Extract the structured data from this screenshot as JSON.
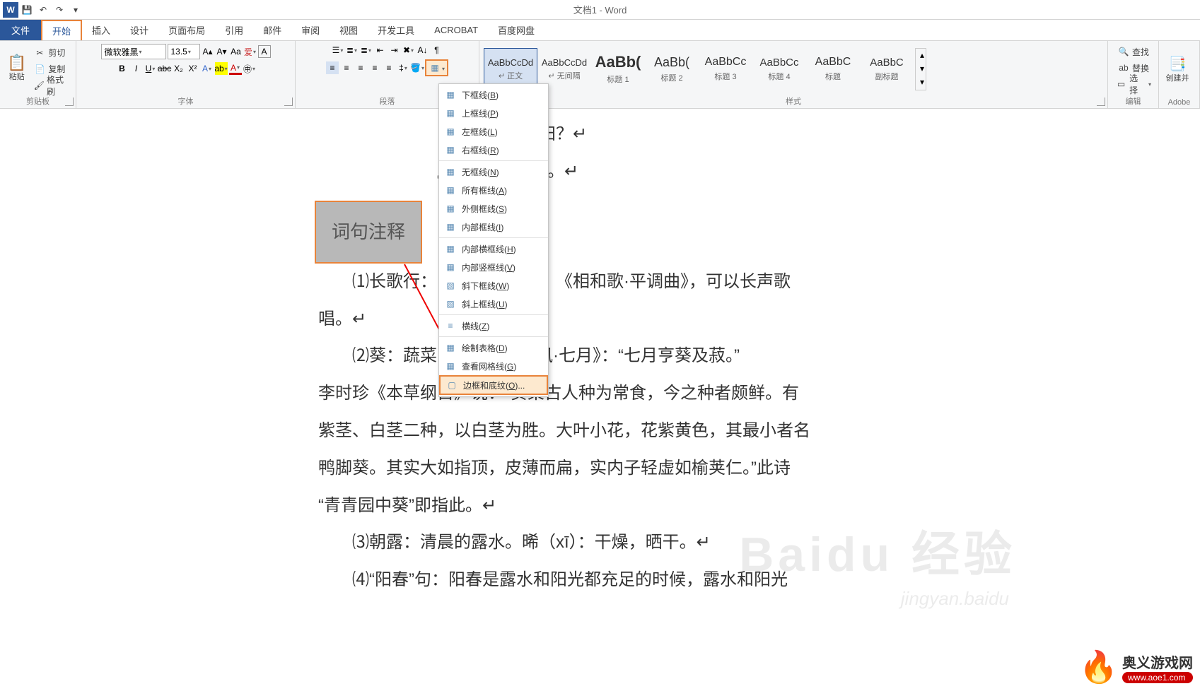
{
  "title": "文档1 - Word",
  "qat": {
    "save": "💾",
    "undo": "↶",
    "redo": "↷"
  },
  "tabs": {
    "file": "文件",
    "home": "开始",
    "insert": "插入",
    "design": "设计",
    "layout": "页面布局",
    "ref": "引用",
    "mail": "邮件",
    "review": "审阅",
    "view": "视图",
    "dev": "开发工具",
    "acrobat": "ACROBAT",
    "baidu": "百度网盘"
  },
  "clipboard": {
    "label": "剪贴板",
    "paste": "粘贴",
    "cut": "剪切",
    "copy": "复制",
    "fmt": "格式刷"
  },
  "font": {
    "label": "字体",
    "name": "微软雅黑",
    "size": "13.5"
  },
  "paragraph": {
    "label": "段落"
  },
  "stylesGroup": {
    "label": "样式"
  },
  "editing": {
    "label": "编辑",
    "find": "查找",
    "replace": "替换",
    "select": "选择"
  },
  "adobe": {
    "label": "Adobe",
    "create": "创建并"
  },
  "styles": [
    {
      "prev": "AaBbCcDd",
      "name": "↵ 正文",
      "size": "13px"
    },
    {
      "prev": "AaBbCcDd",
      "name": "↵ 无间隔",
      "size": "13px"
    },
    {
      "prev": "AaBb(",
      "name": "标题 1",
      "size": "22px",
      "bold": true
    },
    {
      "prev": "AaBb(",
      "name": "标题 2",
      "size": "18px"
    },
    {
      "prev": "AaBbCc",
      "name": "标题 3",
      "size": "16px"
    },
    {
      "prev": "AaBbCc",
      "name": "标题 4",
      "size": "15px"
    },
    {
      "prev": "AaBbC",
      "name": "标题",
      "size": "16px"
    },
    {
      "prev": "AaBbC",
      "name": "副标题",
      "size": "15px"
    }
  ],
  "borderMenu": [
    {
      "ico": "▦",
      "label": "下框线(B)",
      "u": "B"
    },
    {
      "ico": "▦",
      "label": "上框线(P)",
      "u": "P"
    },
    {
      "ico": "▦",
      "label": "左框线(L)",
      "u": "L"
    },
    {
      "ico": "▦",
      "label": "右框线(R)",
      "u": "R"
    },
    {
      "sep": true
    },
    {
      "ico": "▦",
      "label": "无框线(N)",
      "u": "N"
    },
    {
      "ico": "▦",
      "label": "所有框线(A)",
      "u": "A"
    },
    {
      "ico": "▦",
      "label": "外侧框线(S)",
      "u": "S"
    },
    {
      "ico": "▦",
      "label": "内部框线(I)",
      "u": "I"
    },
    {
      "sep": true
    },
    {
      "ico": "▦",
      "label": "内部横框线(H)",
      "u": "H"
    },
    {
      "ico": "▦",
      "label": "内部竖框线(V)",
      "u": "V"
    },
    {
      "ico": "▧",
      "label": "斜下框线(W)",
      "u": "W"
    },
    {
      "ico": "▨",
      "label": "斜上框线(U)",
      "u": "U"
    },
    {
      "sep": true
    },
    {
      "ico": "≡",
      "label": "横线(Z)",
      "u": "Z"
    },
    {
      "sep": true
    },
    {
      "ico": "▦",
      "label": "绘制表格(D)",
      "u": "D"
    },
    {
      "ico": "▦",
      "label": "查看网格线(G)",
      "u": "G"
    },
    {
      "ico": "▢",
      "label": "边框和底纹(O)...",
      "u": "O",
      "hl": true
    }
  ],
  "doc": {
    "l1": "∃，何时复西归？↵",
    "l2": "』，老大徒伤悲。↵",
    "sel": "词句注释",
    "l3a": "⑴长歌行：",
    "l3b": "《相和歌·平调曲》，可以长声歌",
    "l4": "唱。↵",
    "l5": "⑵葵：蔬菜",
    "l5b": "囿风·七月》：“七月亨葵及菽。”",
    "l6": "李时珍《本草纲目》说：“葵菜古人种为常食，今之种者颇鲜。有",
    "l7": "紫茎、白茎二种，以白茎为胜。大叶小花，花紫黄色，其最小者名",
    "l8": "鸭脚葵。其实大如指顶，皮薄而扁，实内子轻虚如榆荚仁。”此诗",
    "l9": "“青青园中葵”即指此。↵",
    "l10": "⑶朝露：清晨的露水。晞（xī）：干燥，晒干。↵",
    "l11": "⑷“阳春”句：阳春是露水和阳光都充足的时候，露水和阳光"
  },
  "watermark": {
    "main": "Baidu 经验",
    "sub": "jingyan.baidu",
    "logo1": "奥义游戏网",
    "logo2": "www.aoe1.com"
  }
}
